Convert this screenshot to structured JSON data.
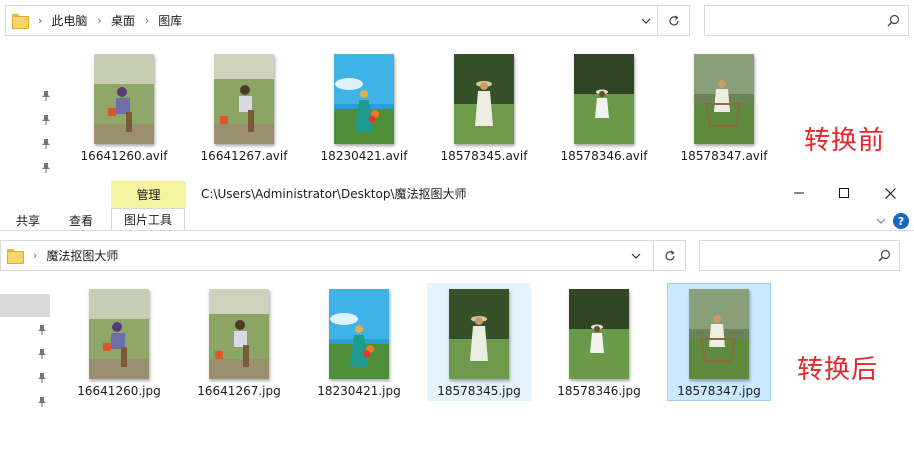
{
  "top_window": {
    "breadcrumb": [
      "此电脑",
      "桌面",
      "图库"
    ],
    "label_tag": "转换前",
    "files": [
      "16641260.avif",
      "16641267.avif",
      "18230421.avif",
      "18578345.avif",
      "18578346.avif",
      "18578347.avif"
    ]
  },
  "bottom_window": {
    "context_tab": "管理",
    "title_path": "C:\\Users\\Administrator\\Desktop\\魔法抠图大师",
    "ribbon_tabs": [
      "共享",
      "查看",
      "图片工具"
    ],
    "breadcrumb": [
      "魔法抠图大师"
    ],
    "label_tag": "转换后",
    "files": [
      "16641260.jpg",
      "16641267.jpg",
      "18230421.jpg",
      "18578345.jpg",
      "18578346.jpg",
      "18578347.jpg"
    ]
  },
  "colors": {
    "tag_red": "#e8262b",
    "manage_tab": "#f4f3a0",
    "selection": "#cce8ff",
    "help_blue": "#1766c1"
  },
  "icons": [
    "folder-icon",
    "chevron-right-icon",
    "chevron-down-icon",
    "refresh-icon",
    "search-icon",
    "pin-icon",
    "minimize-icon",
    "maximize-icon",
    "close-icon",
    "help-icon"
  ]
}
